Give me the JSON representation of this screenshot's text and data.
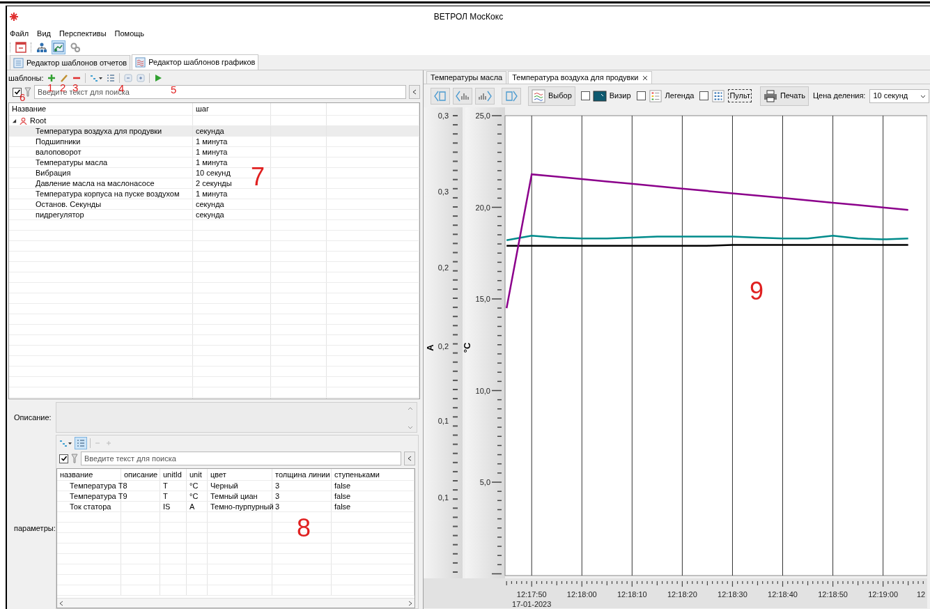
{
  "window": {
    "title": "ВЕТРОЛ МосКокс"
  },
  "menu": [
    "Файл",
    "Вид",
    "Перспективы",
    "Помощь"
  ],
  "toolbar": [
    {
      "kind": "window",
      "selected": false
    },
    {
      "kind": "tree",
      "selected": false
    },
    {
      "kind": "chart",
      "selected": true
    },
    {
      "kind": "gears",
      "selected": false
    }
  ],
  "editor_tabs": [
    {
      "label": "Редактор шаблонов отчетов",
      "selected": false
    },
    {
      "label": "Редактор шаблонов графиков",
      "selected": true
    }
  ],
  "templates": {
    "label": "шаблоны:",
    "search": {
      "placeholder": "Введите текст для поиска",
      "checked": true
    },
    "columns": [
      "Название",
      "шаг"
    ],
    "root": {
      "label": "Root",
      "expanded": true,
      "children": [
        {
          "name": "Температура воздуха для продувки",
          "step": "секунда",
          "selected": true
        },
        {
          "name": "Подшипники",
          "step": "1 минута",
          "selected": false
        },
        {
          "name": "валоповорот",
          "step": "1 минута",
          "selected": false
        },
        {
          "name": "Температуры масла",
          "step": "1 минута",
          "selected": false
        },
        {
          "name": "Вибрация",
          "step": "10 секунд",
          "selected": false
        },
        {
          "name": "Давление масла на маслонасосе",
          "step": "2 секунды",
          "selected": false
        },
        {
          "name": "Температура корпуса на пуске воздухом",
          "step": "1 минута",
          "selected": false
        },
        {
          "name": "Останов. Секунды",
          "step": "секунда",
          "selected": false
        },
        {
          "name": "пидрегулятор",
          "step": "секунда",
          "selected": false
        }
      ]
    }
  },
  "description": {
    "label": "Описание:"
  },
  "parameters": {
    "label": "параметры:",
    "search": {
      "placeholder": "Введите текст для поиска",
      "checked": true
    },
    "columns": [
      "название",
      "описание",
      "unitId",
      "unit",
      "цвет",
      "толщина линии",
      "ступеньками"
    ],
    "rows": [
      [
        "Температура T8",
        "",
        "T",
        "°C",
        "Черный",
        "3",
        "false"
      ],
      [
        "Температура T9",
        "",
        "T",
        "°C",
        "Темный циан",
        "3",
        "false"
      ],
      [
        "Ток статора",
        "",
        "IS",
        "A",
        "Темно-пурпурный",
        "3",
        "false"
      ]
    ]
  },
  "chart_tabs": [
    {
      "label": "Температуры масла",
      "selected": false,
      "closable": false
    },
    {
      "label": "Температура воздуха для продувки",
      "selected": true,
      "closable": true
    }
  ],
  "chart_toolbar": {
    "select_button": "Выбор",
    "toggles": [
      {
        "label": "Визир",
        "checked": false,
        "kind": "sight"
      },
      {
        "label": "Легенда",
        "checked": false,
        "kind": "legend"
      },
      {
        "label": "Пульт",
        "checked": false,
        "kind": "panel"
      }
    ],
    "print_button": "Печать",
    "scale_label": "Цена деления:",
    "scale_value": "10 секунд"
  },
  "chart": {
    "left_axis": {
      "label": "A",
      "ticks": [
        "0,3",
        "0,3",
        "0,2",
        "0,2",
        "0,1",
        "0,1"
      ]
    },
    "date_label": "17-01-2023",
    "cut_tick_label": "12",
    "chart_data": {
      "type": "line",
      "ylabel": "°C",
      "grid": true,
      "ylim": [
        0,
        25
      ],
      "yticks": [
        {
          "value": 5,
          "label": "5,0"
        },
        {
          "value": 10,
          "label": "10,0"
        },
        {
          "value": 15,
          "label": "15,0"
        },
        {
          "value": 20,
          "label": "20,0"
        },
        {
          "value": 25,
          "label": "25,0"
        }
      ],
      "categories": [
        null,
        "12:17:50",
        null,
        "12:18:00",
        null,
        "12:18:10",
        null,
        "12:18:20",
        null,
        "12:18:30",
        null,
        "12:18:40",
        null,
        "12:18:50",
        null,
        "12:19:00",
        null
      ],
      "series": [
        {
          "color": "#000000",
          "values": [
            17.9,
            17.9,
            17.9,
            17.9,
            17.9,
            17.9,
            17.9,
            17.9,
            17.9,
            17.95,
            17.95,
            17.95,
            17.95,
            17.95,
            17.95,
            17.95,
            17.95
          ]
        },
        {
          "color": "#008b8b",
          "values": [
            18.2,
            18.45,
            18.35,
            18.3,
            18.3,
            18.35,
            18.4,
            18.4,
            18.4,
            18.4,
            18.35,
            18.3,
            18.3,
            18.45,
            18.3,
            18.25,
            18.3
          ]
        },
        {
          "color": "#8b008b",
          "values": [
            14.5,
            21.8,
            21.67,
            21.54,
            21.41,
            21.28,
            21.15,
            21.02,
            20.89,
            20.76,
            20.64,
            20.51,
            20.38,
            20.25,
            20.12,
            19.99,
            19.86
          ]
        }
      ]
    }
  },
  "annotations": [
    "1",
    "2",
    "3",
    "4",
    "5",
    "6",
    "7",
    "8",
    "9"
  ]
}
